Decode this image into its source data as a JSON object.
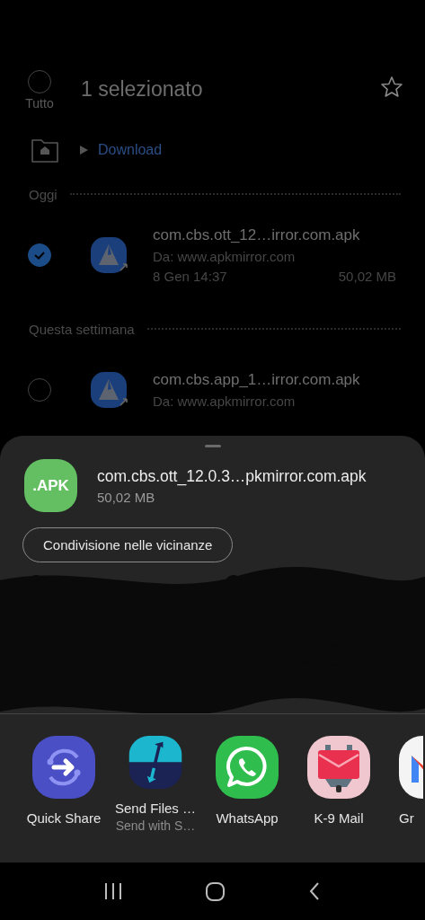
{
  "header": {
    "select_all_label": "Tutto",
    "select_all_checked": false,
    "title": "1 selezionato"
  },
  "breadcrumb": [
    {
      "label": "Download"
    }
  ],
  "sections": [
    {
      "title": "Oggi",
      "files": [
        {
          "name": "com.cbs.ott_12…irror.com.apk",
          "source": "Da: www.apkmirror.com",
          "date": "8 Gen 14:37",
          "size": "50,02 MB",
          "selected": true
        }
      ]
    },
    {
      "title": "Questa settimana",
      "files": [
        {
          "name": "com.cbs.app_1…irror.com.apk",
          "source": "Da: www.apkmirror.com",
          "selected": false
        }
      ]
    }
  ],
  "share_sheet": {
    "file_type": ".APK",
    "file_name": "com.cbs.ott_12.0.3…pkmirror.com.apk",
    "file_size": "50,02 MB",
    "nearby_button": "Condivisione nelle vicinanze",
    "apps": [
      {
        "label": "Quick Share"
      },
      {
        "label": "Send Files …",
        "sublabel": "Send with S…"
      },
      {
        "label": "WhatsApp"
      },
      {
        "label": "K-9 Mail"
      },
      {
        "label": "Gr"
      }
    ]
  }
}
